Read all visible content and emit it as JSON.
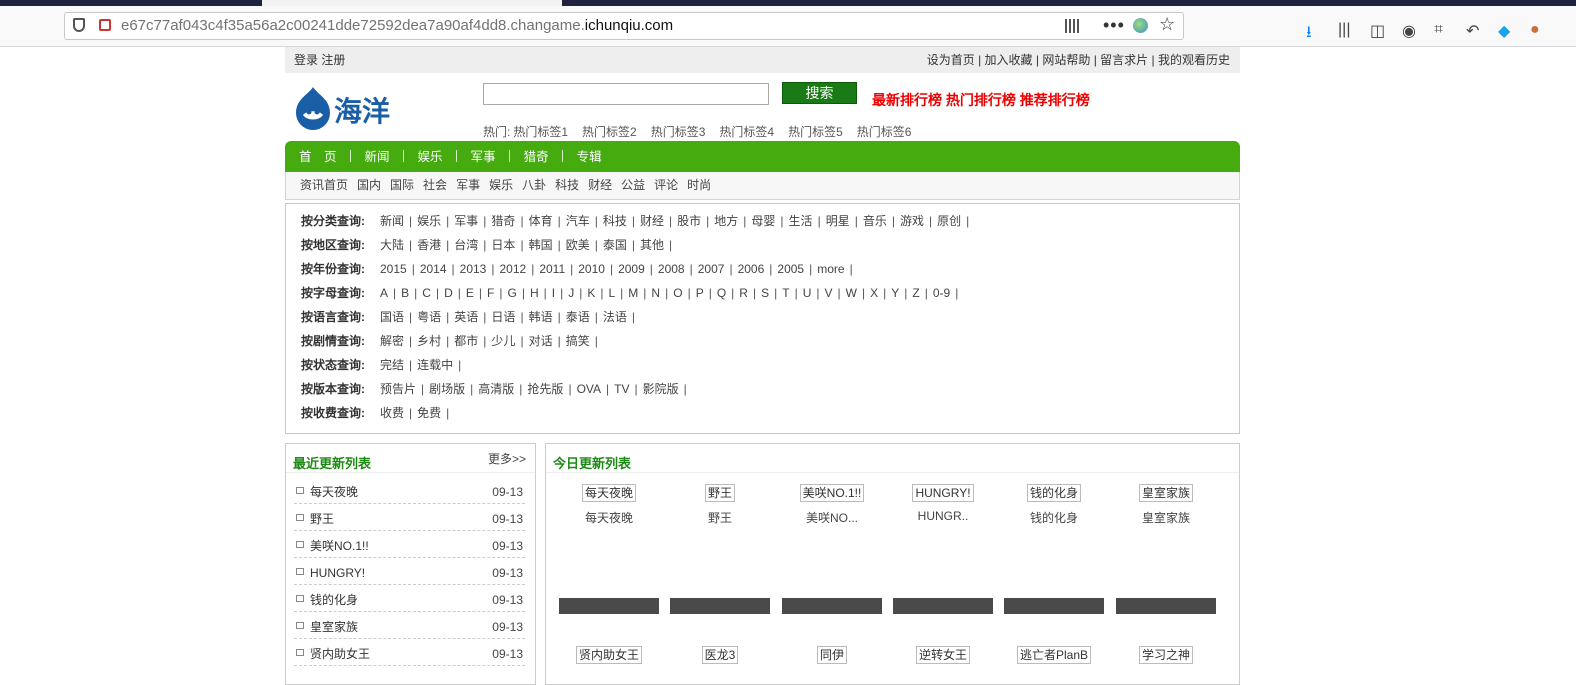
{
  "browser": {
    "url_prefix": "e67c77af043c4f35a56a2c00241dde72592dea7a90af4dd8.changame.",
    "url_domain": "ichunqiu.com"
  },
  "topbar": {
    "login": "登录",
    "register": "注册",
    "right_links": [
      "设为首页",
      "加入收藏",
      "网站帮助",
      "留言求片",
      "我的观看历史"
    ]
  },
  "header": {
    "logo_text": "海洋",
    "search_button": "搜索",
    "ranks": [
      "最新排行榜",
      "热门排行榜",
      "推荐排行榜"
    ],
    "hot_label": "热门:",
    "hot_tags": [
      "热门标签1",
      "热门标签2",
      "热门标签3",
      "热门标签4",
      "热门标签5",
      "热门标签6"
    ]
  },
  "nav": [
    "首　页",
    "新闻",
    "娱乐",
    "军事",
    "猎奇",
    "专辑"
  ],
  "subnav": [
    "资讯首页",
    "国内",
    "国际",
    "社会",
    "军事",
    "娱乐",
    "八卦",
    "科技",
    "财经",
    "公益",
    "评论",
    "时尚"
  ],
  "filters": [
    {
      "label": "按分类查询:",
      "values": [
        "新闻",
        "娱乐",
        "军事",
        "猎奇",
        "体育",
        "汽车",
        "科技",
        "财经",
        "股市",
        "地方",
        "母婴",
        "生活",
        "明星",
        "音乐",
        "游戏",
        "原创"
      ]
    },
    {
      "label": "按地区查询:",
      "values": [
        "大陆",
        "香港",
        "台湾",
        "日本",
        "韩国",
        "欧美",
        "泰国",
        "其他"
      ]
    },
    {
      "label": "按年份查询:",
      "values": [
        "2015",
        "2014",
        "2013",
        "2012",
        "2011",
        "2010",
        "2009",
        "2008",
        "2007",
        "2006",
        "2005",
        "more"
      ]
    },
    {
      "label": "按字母查询:",
      "values": [
        "A",
        "B",
        "C",
        "D",
        "E",
        "F",
        "G",
        "H",
        "I",
        "J",
        "K",
        "L",
        "M",
        "N",
        "O",
        "P",
        "Q",
        "R",
        "S",
        "T",
        "U",
        "V",
        "W",
        "X",
        "Y",
        "Z",
        "0-9"
      ]
    },
    {
      "label": "按语言查询:",
      "values": [
        "国语",
        "粤语",
        "英语",
        "日语",
        "韩语",
        "泰语",
        "法语"
      ]
    },
    {
      "label": "按剧情查询:",
      "values": [
        "解密",
        "乡村",
        "都市",
        "少儿",
        "对话",
        "搞笑"
      ]
    },
    {
      "label": "按状态查询:",
      "values": [
        "完结",
        "连载中"
      ]
    },
    {
      "label": "按版本查询:",
      "values": [
        "预告片",
        "剧场版",
        "高清版",
        "抢先版",
        "OVA",
        "TV",
        "影院版"
      ]
    },
    {
      "label": "按收费查询:",
      "values": [
        "收费",
        "免费"
      ]
    }
  ],
  "recent": {
    "title": "最近更新列表",
    "more": "更多>>",
    "items": [
      {
        "name": "每天夜晚",
        "date": "09-13"
      },
      {
        "name": "野王",
        "date": "09-13"
      },
      {
        "name": "美咲NO.1!!",
        "date": "09-13"
      },
      {
        "name": "HUNGRY!",
        "date": "09-13"
      },
      {
        "name": "钱的化身",
        "date": "09-13"
      },
      {
        "name": "皇室家族",
        "date": "09-13"
      },
      {
        "name": "贤内助女王",
        "date": "09-13"
      }
    ]
  },
  "today": {
    "title": "今日更新列表",
    "row1": [
      {
        "tag": "每天夜晚",
        "name": "每天夜晚"
      },
      {
        "tag": "野王",
        "name": "野王"
      },
      {
        "tag": "美咲NO.1!!",
        "name": "美咲NO..."
      },
      {
        "tag": "HUNGRY!",
        "name": "HUNGR.."
      },
      {
        "tag": "钱的化身",
        "name": "钱的化身"
      },
      {
        "tag": "皇室家族",
        "name": "皇室家族"
      }
    ],
    "row2": [
      {
        "tag": "贤内助女王"
      },
      {
        "tag": "医龙3"
      },
      {
        "tag": "同伊"
      },
      {
        "tag": "逆转女王"
      },
      {
        "tag": "逃亡者PlanB"
      },
      {
        "tag": "学习之神"
      }
    ]
  }
}
